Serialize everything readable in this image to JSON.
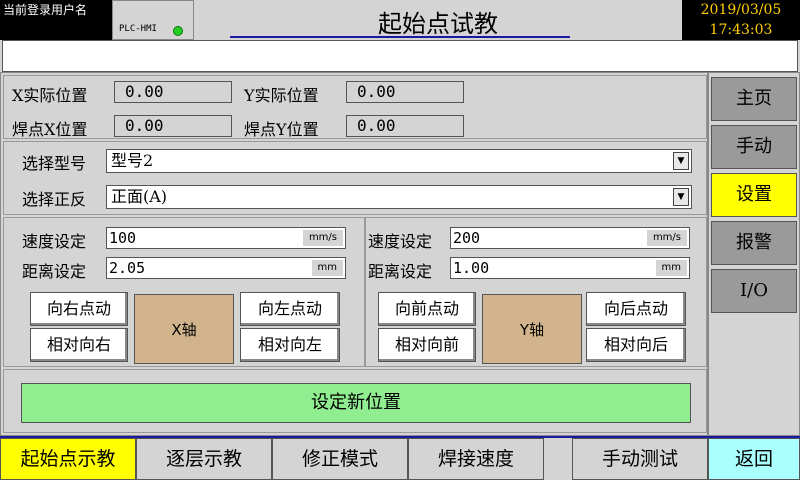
{
  "header": {
    "user_label": "当前登录用户名",
    "plc_label": "PLC-HMI",
    "title": "起始点试教",
    "date": "2019/03/05",
    "time": "17:43:03"
  },
  "positions": {
    "x_actual_label": "X实际位置",
    "x_actual_value": "0.00",
    "y_actual_label": "Y实际位置",
    "y_actual_value": "0.00",
    "weld_x_label": "焊点X位置",
    "weld_x_value": "0.00",
    "weld_y_label": "焊点Y位置",
    "weld_y_value": "0.00"
  },
  "selection": {
    "model_label": "选择型号",
    "model_value": "型号2",
    "side_label": "选择正反",
    "side_value": "正面(A)"
  },
  "x_panel": {
    "speed_label": "速度设定",
    "speed_value": "100",
    "speed_unit": "mm/s",
    "distance_label": "距离设定",
    "distance_value": "2.05",
    "distance_unit": "mm",
    "jog_right": "向右点动",
    "rel_right": "相对向右",
    "axis_label": "X轴",
    "jog_left": "向左点动",
    "rel_left": "相对向左"
  },
  "y_panel": {
    "speed_label": "速度设定",
    "speed_value": "200",
    "speed_unit": "mm/s",
    "distance_label": "距离设定",
    "distance_value": "1.00",
    "distance_unit": "mm",
    "jog_forward": "向前点动",
    "rel_forward": "相对向前",
    "axis_label": "Y轴",
    "jog_back": "向后点动",
    "rel_back": "相对向后"
  },
  "set_new_position": "设定新位置",
  "right_nav": [
    "主页",
    "手动",
    "设置",
    "报警",
    "I/O"
  ],
  "right_nav_active": "设置",
  "bottom_nav": [
    "起始点示教",
    "逐层示教",
    "修正模式",
    "焊接速度",
    "手动测试",
    "返回"
  ],
  "bottom_nav_active": "起始点示教",
  "colors": {
    "active": "#ffff00",
    "back": "#aaffff",
    "new_position": "#90ee90",
    "axis_block": "#d2b48c",
    "status_led": "#22cc22",
    "date_text": "#ffcc00"
  }
}
